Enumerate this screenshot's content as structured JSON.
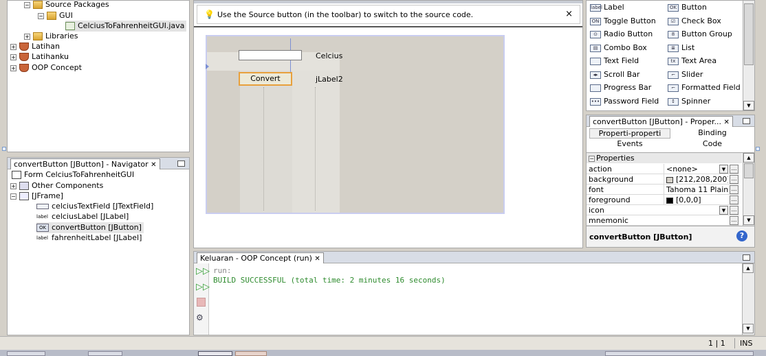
{
  "project_tree": {
    "items": [
      {
        "label": "Source Packages"
      },
      {
        "label": "GUI"
      },
      {
        "label": "CelciusToFahrenheitGUI.java"
      },
      {
        "label": "Libraries"
      },
      {
        "label": "Latihan"
      },
      {
        "label": "Latihanku"
      },
      {
        "label": "OOP Concept"
      }
    ]
  },
  "navigator": {
    "title": "convertButton [JButton] - Navigator",
    "items": [
      {
        "label": "Form CelciusToFahrenheitGUI"
      },
      {
        "label": "Other Components"
      },
      {
        "label": "[JFrame]"
      },
      {
        "label": "celciusTextField [JTextField]"
      },
      {
        "label": "celciusLabel [JLabel]"
      },
      {
        "label": "convertButton [JButton]"
      },
      {
        "label": "fahrenheitLabel [JLabel]"
      }
    ],
    "icon_labels": {
      "label": "label",
      "ok": "OK"
    }
  },
  "editor": {
    "hint": "Use the Source button (in the toolbar) to switch to the source code.",
    "close": "×",
    "form": {
      "celcius_label": "Celcius",
      "convert_button": "Convert",
      "jlabel2": "jLabel2"
    }
  },
  "palette": {
    "items": [
      {
        "label": "Label",
        "icon": "label"
      },
      {
        "label": "Button",
        "icon": "OK"
      },
      {
        "label": "Toggle Button",
        "icon": "ON"
      },
      {
        "label": "Check Box",
        "icon": "☑"
      },
      {
        "label": "Radio Button",
        "icon": "⊙"
      },
      {
        "label": "Button Group",
        "icon": "8"
      },
      {
        "label": "Combo Box",
        "icon": "▤"
      },
      {
        "label": "List",
        "icon": "≣"
      },
      {
        "label": "Text Field",
        "icon": ""
      },
      {
        "label": "Text Area",
        "icon": "tx"
      },
      {
        "label": "Scroll Bar",
        "icon": "◂▸"
      },
      {
        "label": "Slider",
        "icon": "⌐"
      },
      {
        "label": "Progress Bar",
        "icon": ""
      },
      {
        "label": "Formatted Field",
        "icon": "⌐"
      },
      {
        "label": "Password Field",
        "icon": "•••"
      },
      {
        "label": "Spinner",
        "icon": "↕"
      }
    ]
  },
  "properties": {
    "title": "convertButton [JButton] - Proper...",
    "tabs": [
      "Properti-properti",
      "Binding",
      "Events",
      "Code"
    ],
    "section": "Properties",
    "rows": [
      {
        "name": "action",
        "value": "<none>"
      },
      {
        "name": "background",
        "value": "[212,208,200]",
        "swatch": "#d4d0c8"
      },
      {
        "name": "font",
        "value": "Tahoma 11 Plain"
      },
      {
        "name": "foreground",
        "value": "[0,0,0]",
        "swatch": "#000000"
      },
      {
        "name": "icon",
        "value": ""
      },
      {
        "name": "mnemonic",
        "value": ""
      }
    ],
    "footer": "convertButton [JButton]",
    "help": "?"
  },
  "output": {
    "title": "Keluaran - OOP Concept (run)",
    "lines": [
      "run:",
      "BUILD SUCCESSFUL (total time: 2 minutes 16 seconds)"
    ]
  },
  "status": {
    "position": "1 | 1",
    "mode": "INS"
  },
  "colors": {
    "success_green": "#2e8b2e",
    "selection_orange": "#e8a03c",
    "accent_blue": "#3366cc"
  }
}
